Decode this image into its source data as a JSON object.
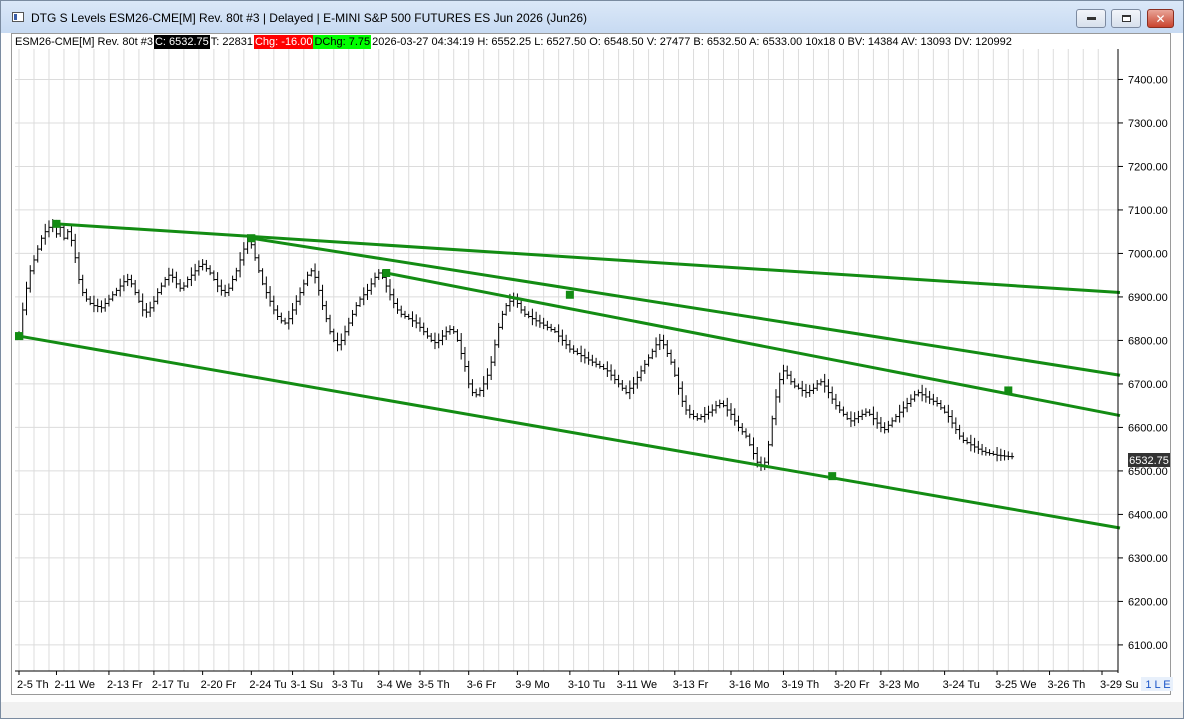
{
  "window": {
    "title": "DTG S Levels ESM26-CME[M]  Rev. 80t #3 | Delayed | E-MINI S&P 500 FUTURES ES Jun 2026 (Jun26)",
    "icons": [
      "app-icon",
      "minimize-icon",
      "maximize-icon",
      "close-icon"
    ]
  },
  "info_bar": {
    "symbol": "ESM26-CME[M]  Rev. 80t #3",
    "close": "C: 6532.75",
    "ticks": "T: 22831",
    "chg": "Chg: -16.00",
    "dchg": "DChg: 7.75",
    "details": "2026-03-27 04:34:19 H: 6552.25 L: 6527.50 O: 6548.50 V: 27477 B: 6532.50 A: 6533.00 10x18 0 BV: 14384 AV: 13093 DV: 120992"
  },
  "colors": {
    "trendline": "#138c13",
    "bars": "#000000",
    "grid": "#dcdcdc",
    "chg_bg": "#ff0000",
    "dchg_bg": "#00ff00"
  },
  "price_label": "6532.75",
  "mode_label": "1 L E",
  "chart_data": {
    "type": "bar",
    "ylim": [
      6040,
      7470
    ],
    "yticks": [
      "7400.00",
      "7300.00",
      "7200.00",
      "7100.00",
      "7000.00",
      "6900.00",
      "6800.00",
      "6700.00",
      "6600.00",
      "6500.00",
      "6400.00",
      "6300.00",
      "6200.00",
      "6100.00"
    ],
    "xticks": [
      "2-5 Th",
      "2-11 We",
      "2-13 Fr",
      "2-17 Tu",
      "2-20 Fr",
      "2-24 Tu",
      "3-1 Su",
      "3-3 Tu",
      "3-4 We",
      "3-5 Th",
      "3-6 Fr",
      "3-9 Mo",
      "3-10 Tu",
      "3-11 We",
      "3-13 Fr",
      "3-16 Mo",
      "3-19 Th",
      "3-20 Fr",
      "3-23 Mo",
      "3-24 Tu",
      "3-25 We",
      "3-26 Th",
      "3-29 Su"
    ],
    "xtick_index": [
      0,
      10,
      24,
      36,
      49,
      62,
      73,
      84,
      96,
      107,
      120,
      133,
      147,
      160,
      175,
      190,
      204,
      218,
      230,
      247,
      261,
      275,
      289
    ],
    "bar_count": 290,
    "closes": [
      6815,
      6870,
      6920,
      6960,
      6985,
      7010,
      7035,
      7050,
      7060,
      7065,
      7045,
      7060,
      7035,
      7050,
      7030,
      6990,
      6940,
      6910,
      6895,
      6885,
      6880,
      6878,
      6875,
      6885,
      6895,
      6905,
      6915,
      6925,
      6935,
      6940,
      6930,
      6910,
      6890,
      6870,
      6865,
      6875,
      6890,
      6910,
      6925,
      6940,
      6950,
      6945,
      6930,
      6920,
      6925,
      6940,
      6950,
      6960,
      6970,
      6975,
      6965,
      6955,
      6940,
      6925,
      6915,
      6910,
      6920,
      6940,
      6960,
      6985,
      7010,
      7030,
      7020,
      6990,
      6960,
      6930,
      6910,
      6890,
      6870,
      6855,
      6845,
      6840,
      6850,
      6870,
      6890,
      6910,
      6930,
      6950,
      6960,
      6945,
      6915,
      6880,
      6850,
      6820,
      6800,
      6790,
      6800,
      6820,
      6840,
      6860,
      6880,
      6895,
      6905,
      6915,
      6930,
      6945,
      6955,
      6945,
      6925,
      6905,
      6885,
      6870,
      6860,
      6855,
      6850,
      6845,
      6840,
      6830,
      6820,
      6810,
      6800,
      6795,
      6800,
      6810,
      6820,
      6825,
      6820,
      6800,
      6770,
      6740,
      6700,
      6680,
      6675,
      6685,
      6700,
      6720,
      6750,
      6790,
      6830,
      6860,
      6880,
      6890,
      6895,
      6885,
      6870,
      6860,
      6855,
      6850,
      6845,
      6840,
      6835,
      6830,
      6825,
      6820,
      6810,
      6800,
      6790,
      6780,
      6775,
      6770,
      6765,
      6760,
      6755,
      6750,
      6745,
      6740,
      6735,
      6730,
      6720,
      6710,
      6700,
      6690,
      6680,
      6690,
      6700,
      6715,
      6730,
      6745,
      6760,
      6775,
      6790,
      6800,
      6790,
      6770,
      6750,
      6720,
      6690,
      6660,
      6640,
      6630,
      6625,
      6620,
      6625,
      6630,
      6635,
      6640,
      6650,
      6655,
      6650,
      6640,
      6630,
      6615,
      6600,
      6590,
      6580,
      6560,
      6540,
      6520,
      6510,
      6520,
      6560,
      6620,
      6670,
      6710,
      6730,
      6720,
      6705,
      6695,
      6690,
      6685,
      6680,
      6685,
      6690,
      6700,
      6705,
      6695,
      6680,
      6665,
      6650,
      6640,
      6630,
      6620,
      6615,
      6620,
      6625,
      6630,
      6635,
      6630,
      6620,
      6610,
      6600,
      6595,
      6605,
      6615,
      6625,
      6635,
      6645,
      6655,
      6665,
      6675,
      6680,
      6675,
      6670,
      6665,
      6660,
      6655,
      6645,
      6635,
      6625,
      6610,
      6595,
      6580,
      6570,
      6565,
      6560,
      6555,
      6550,
      6545,
      6542,
      6540,
      6538,
      6536,
      6535,
      6534,
      6533,
      6532.75
    ],
    "trendlines": [
      {
        "x": [
          10,
          285
        ],
        "y": [
          7068,
          6915
        ]
      },
      {
        "x": [
          62,
          285
        ],
        "y": [
          7035,
          6732
        ]
      },
      {
        "x": [
          98,
          285
        ],
        "y": [
          6955,
          6642
        ]
      },
      {
        "x": [
          0,
          285
        ],
        "y": [
          6810,
          6382
        ]
      }
    ],
    "anchors": [
      {
        "x": 0,
        "y": 6810
      },
      {
        "x": 10,
        "y": 7068
      },
      {
        "x": 62,
        "y": 7035
      },
      {
        "x": 98,
        "y": 6955
      },
      {
        "x": 147,
        "y": 6905
      },
      {
        "x": 217,
        "y": 6488
      },
      {
        "x": 264,
        "y": 6685
      }
    ]
  }
}
